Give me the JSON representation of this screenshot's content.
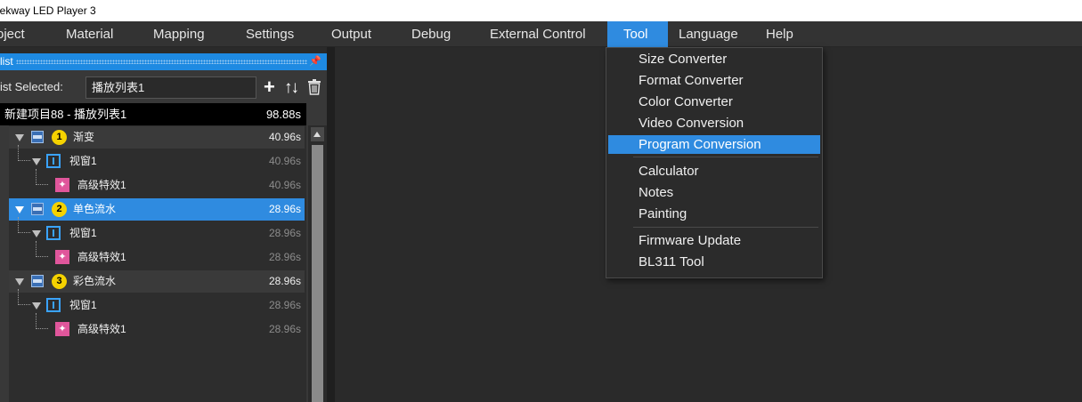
{
  "window": {
    "title": "eekway LED Player 3"
  },
  "menubar": {
    "items": [
      "oject",
      "Material",
      "Mapping",
      "Settings",
      "Output",
      "Debug",
      "External Control",
      "Tool",
      "Language",
      "Help"
    ]
  },
  "tool_menu": {
    "items": [
      "Size Converter",
      "Format Converter",
      "Color Converter",
      "Video Conversion",
      "Program Conversion",
      "Calculator",
      "Notes",
      "Painting",
      "Firmware Update",
      "BL311 Tool"
    ],
    "highlighted": "Program Conversion"
  },
  "panel": {
    "title": "list",
    "selected_label": "ist Selected:",
    "selected_value": "播放列表1",
    "icons": [
      "add-icon",
      "sort-icon",
      "trash-icon"
    ],
    "project": {
      "name": "新建项目88 - 播放列表1",
      "duration": "98.88s"
    },
    "programs": [
      {
        "num": "1",
        "name": "渐变",
        "duration": "40.96s",
        "window": "视窗1",
        "window_duration": "40.96s",
        "effect": "高级特效1",
        "effect_duration": "40.96s"
      },
      {
        "num": "2",
        "name": "单色流水",
        "duration": "28.96s",
        "window": "视窗1",
        "window_duration": "28.96s",
        "effect": "高级特效1",
        "effect_duration": "28.96s"
      },
      {
        "num": "3",
        "name": "彩色流水",
        "duration": "28.96s",
        "window": "视窗1",
        "window_duration": "28.96s",
        "effect": "高级特效1",
        "effect_duration": "28.96s"
      }
    ]
  },
  "colors": {
    "accent": "#2f8be0",
    "badge": "#f5d200",
    "effect_icon": "#e0569b",
    "window_icon": "#3aa3ff"
  }
}
